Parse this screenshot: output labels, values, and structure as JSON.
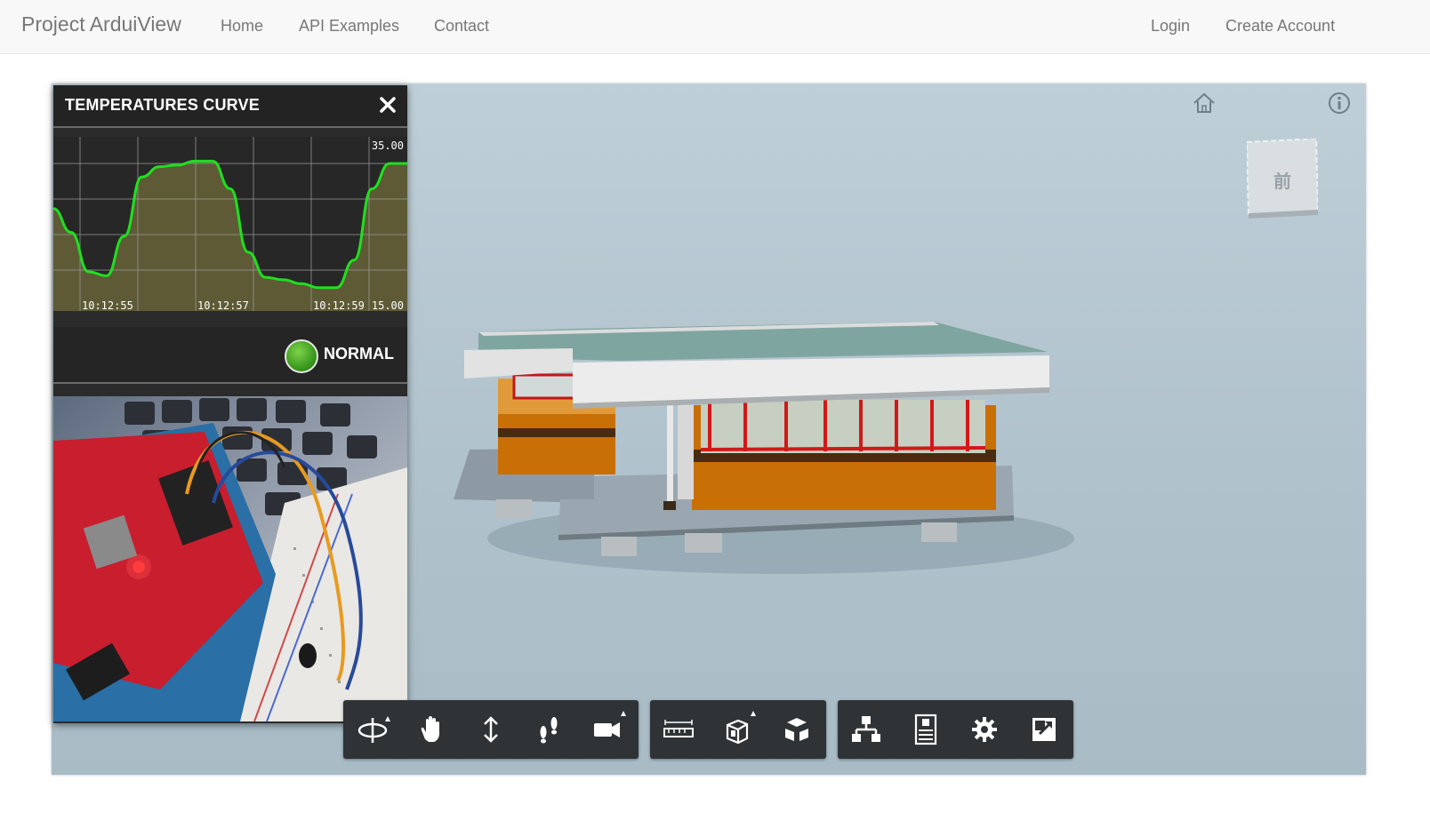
{
  "navbar": {
    "brand": "Project ArduiView",
    "links": [
      "Home",
      "API Examples",
      "Contact"
    ],
    "right_links": [
      "Login",
      "Create Account"
    ]
  },
  "panel": {
    "title": "TEMPERATURES CURVE",
    "close_icon": "close-icon",
    "status_text": "NORMAL",
    "status_color": "#3b9a1e",
    "photo_icon": "arduino-photo"
  },
  "chart_data": {
    "type": "line",
    "y_max_label": "35.00",
    "y_min_label": "15.00",
    "ylim": [
      15,
      35
    ],
    "x_tick_labels": [
      "10:12:55",
      "10:12:57",
      "10:12:59"
    ],
    "series": [
      {
        "color": "#1fe01f",
        "fill": "#5e5a36",
        "x": [
          0,
          0.6,
          1.2,
          1.8,
          2.4,
          3.0,
          3.6,
          4.2,
          4.8,
          5.4,
          6.0,
          6.6,
          7.2,
          7.8,
          8.4,
          9.0,
          9.6,
          10.2,
          10.8,
          11.4,
          12.0
        ],
        "values": [
          27.5,
          24.5,
          19.5,
          19.0,
          24.0,
          31.5,
          32.8,
          33.0,
          33.5,
          33.5,
          30.0,
          22.0,
          18.8,
          18.5,
          18.0,
          17.5,
          17.5,
          21.0,
          30.0,
          33.2,
          33.2
        ]
      }
    ]
  },
  "viewer": {
    "home_icon": "home-icon",
    "info_icon": "info-icon",
    "viewcube_label": "前"
  },
  "toolbar": {
    "groups": [
      [
        "orbit-icon",
        "pan-icon",
        "dolly-icon",
        "walk-icon",
        "camera-icon"
      ],
      [
        "measure-icon",
        "section-icon",
        "explode-icon"
      ],
      [
        "model-tree-icon",
        "properties-icon",
        "settings-icon",
        "fullscreen-icon"
      ]
    ]
  }
}
